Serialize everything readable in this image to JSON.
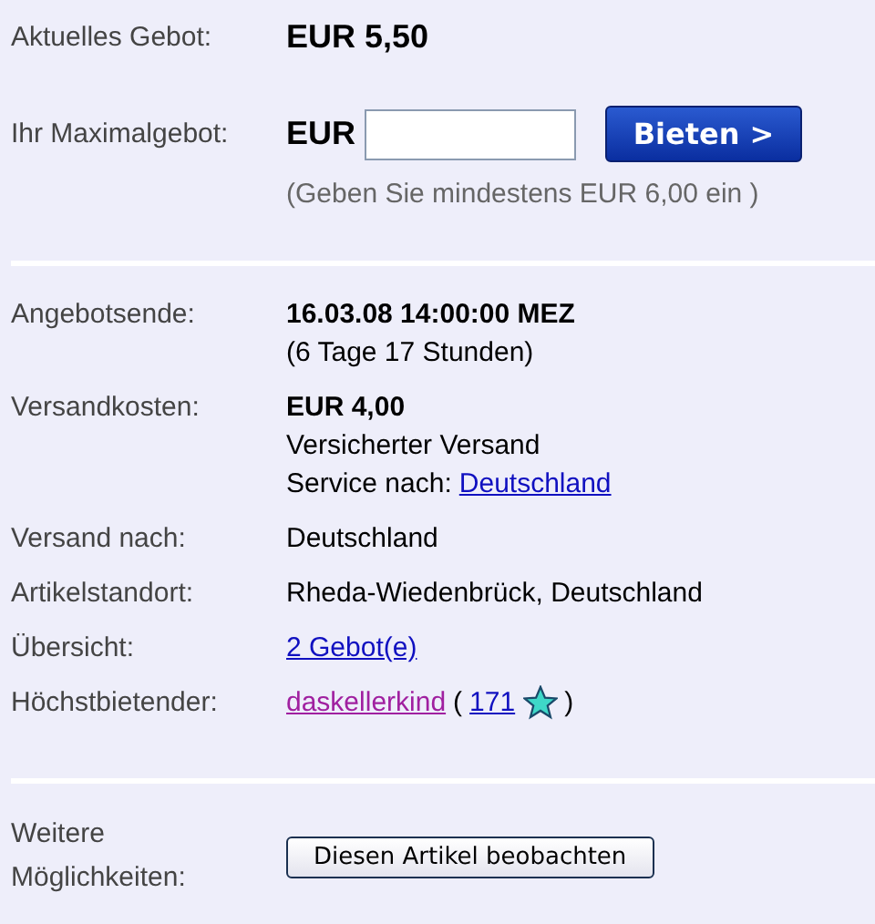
{
  "current_bid": {
    "label": "Aktuelles Gebot:",
    "value": "EUR 5,50"
  },
  "max_bid": {
    "label": "Ihr Maximalgebot:",
    "currency": "EUR",
    "button": "Bieten >",
    "hint": "(Geben Sie mindestens EUR 6,00 ein )"
  },
  "details": [
    {
      "label": "Angebotsende:",
      "lines": [
        [
          {
            "kind": "bold",
            "text": "16.03.08 14:00:00 MEZ"
          }
        ],
        [
          {
            "kind": "plain",
            "text": "(6 Tage 17 Stunden)"
          }
        ]
      ]
    },
    {
      "label": "Versandkosten:",
      "lines": [
        [
          {
            "kind": "bold",
            "text": "EUR 4,00"
          }
        ],
        [
          {
            "kind": "plain",
            "text": "Versicherter Versand"
          }
        ],
        [
          {
            "kind": "plain",
            "text": "Service nach:"
          },
          {
            "kind": "link",
            "text": "Deutschland"
          }
        ]
      ]
    },
    {
      "label": "Versand nach:",
      "lines": [
        [
          {
            "kind": "plain",
            "text": "Deutschland"
          }
        ]
      ]
    },
    {
      "label": "Artikelstandort:",
      "lines": [
        [
          {
            "kind": "plain",
            "text": "Rheda-Wiedenbrück, Deutschland"
          }
        ]
      ]
    },
    {
      "label": "Übersicht:",
      "lines": [
        [
          {
            "kind": "link",
            "text": "2 Gebot(e)"
          }
        ]
      ]
    },
    {
      "label": "Höchstbietender:",
      "lines": [
        [
          {
            "kind": "user",
            "text": "daskellerkind"
          },
          {
            "kind": "plain",
            "text": "("
          },
          {
            "kind": "link",
            "text": "171"
          },
          {
            "kind": "star"
          },
          {
            "kind": "plain",
            "text": ")"
          }
        ]
      ]
    }
  ],
  "more": {
    "label": "Weitere Möglichkeiten:",
    "button": "Diesen Artikel beobachten"
  }
}
